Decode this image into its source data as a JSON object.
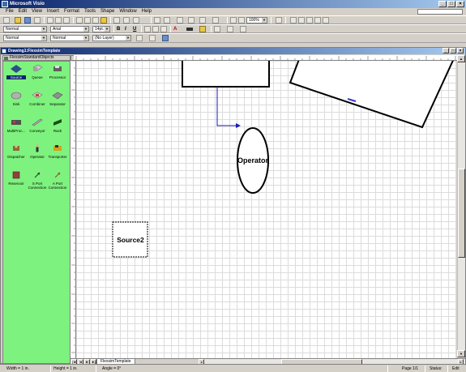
{
  "window": {
    "title": "Microsoft Visio"
  },
  "menu": [
    "File",
    "Edit",
    "View",
    "Insert",
    "Format",
    "Tools",
    "Shape",
    "Window",
    "Help"
  ],
  "toolbar_format": {
    "style": "Normal",
    "font": "Arial",
    "font_size": "14pt.",
    "bold": "B",
    "italic": "I",
    "underline": "U",
    "font_color_letter": "A"
  },
  "toolbar_standard": {
    "zoom": "100%"
  },
  "toolbar_line": {
    "line_style": "Normal",
    "fill_style": "Normal",
    "layer": "(No Layer)"
  },
  "document": {
    "title": "Drawing1:FlexsimTemplate"
  },
  "stencil": {
    "title": "FlexsimStandardObjects",
    "items": [
      {
        "label": "Source",
        "icon": "source-icon",
        "selected": true
      },
      {
        "label": "Queue",
        "icon": "queue-icon"
      },
      {
        "label": "Processor",
        "icon": "processor-icon"
      },
      {
        "label": "Sink",
        "icon": "sink-icon"
      },
      {
        "label": "Combiner",
        "icon": "combiner-icon"
      },
      {
        "label": "Separator",
        "icon": "separator-icon"
      },
      {
        "label": "MultiProc...",
        "icon": "multiprocessor-icon"
      },
      {
        "label": "Conveyor",
        "icon": "conveyor-icon"
      },
      {
        "label": "Rack",
        "icon": "rack-icon"
      },
      {
        "label": "Dispatcher",
        "icon": "dispatcher-icon"
      },
      {
        "label": "Operator",
        "icon": "operator-icon"
      },
      {
        "label": "Transporter",
        "icon": "transporter-icon"
      },
      {
        "label": "Reservoir",
        "icon": "reservoir-icon"
      },
      {
        "label": "S Port Connection",
        "icon": "s-port-connection-icon"
      },
      {
        "label": "A Port Connection",
        "icon": "a-port-connection-icon"
      }
    ]
  },
  "canvas": {
    "shapes": [
      {
        "kind": "rectangle",
        "label": ""
      },
      {
        "kind": "rotated-rectangle",
        "label": ""
      },
      {
        "kind": "ellipse",
        "label": "Operator"
      },
      {
        "kind": "rectangle",
        "label": "Source2"
      }
    ]
  },
  "page_tab": "FlexsimTemplate",
  "status": {
    "width": "Width = 1 in.",
    "height": "Height = 1 in.",
    "angle": "Angle = 0°",
    "page": "Page 1/1",
    "status_label": "Status:",
    "mode": "Edit"
  },
  "colors": {
    "stencil_bg": "#7ef27e",
    "titlebar": "#0a246a",
    "connector": "#1a1ab8",
    "grid": "#dcdcdc"
  }
}
